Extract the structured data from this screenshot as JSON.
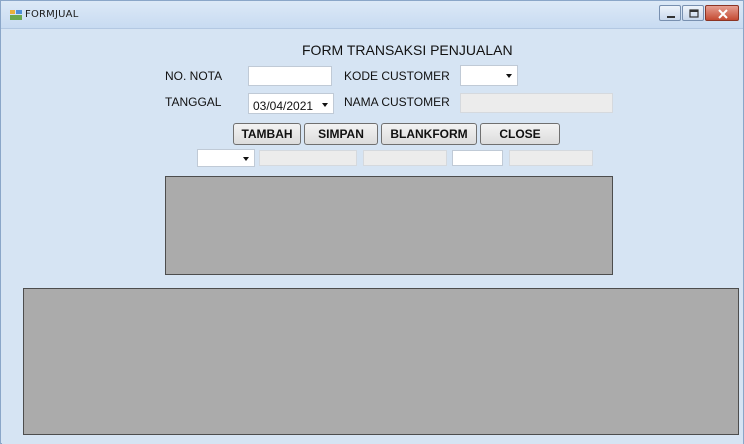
{
  "window": {
    "title": "FORMJUAL"
  },
  "form": {
    "title": "FORM TRANSAKSI PENJUALAN"
  },
  "fields": {
    "no_nota_label": "NO. NOTA",
    "no_nota_value": "",
    "kode_customer_label": "KODE CUSTOMER",
    "kode_customer_value": "",
    "tanggal_label": "TANGGAL",
    "tanggal_value": "03/04/2021",
    "nama_customer_label": "NAMA CUSTOMER",
    "nama_customer_value": ""
  },
  "buttons": {
    "tambah": "TAMBAH",
    "simpan": "SIMPAN",
    "blankform": "BLANKFORM",
    "close": "CLOSE"
  },
  "icons": {
    "app": "form-icon",
    "minimize": "minimize-icon",
    "maximize": "maximize-icon",
    "close": "close-icon",
    "dropdown": "chevron-down-icon"
  },
  "colors": {
    "form_background": "#d6e4f3",
    "grid_background": "#ababab",
    "close_button": "#c44a32"
  }
}
